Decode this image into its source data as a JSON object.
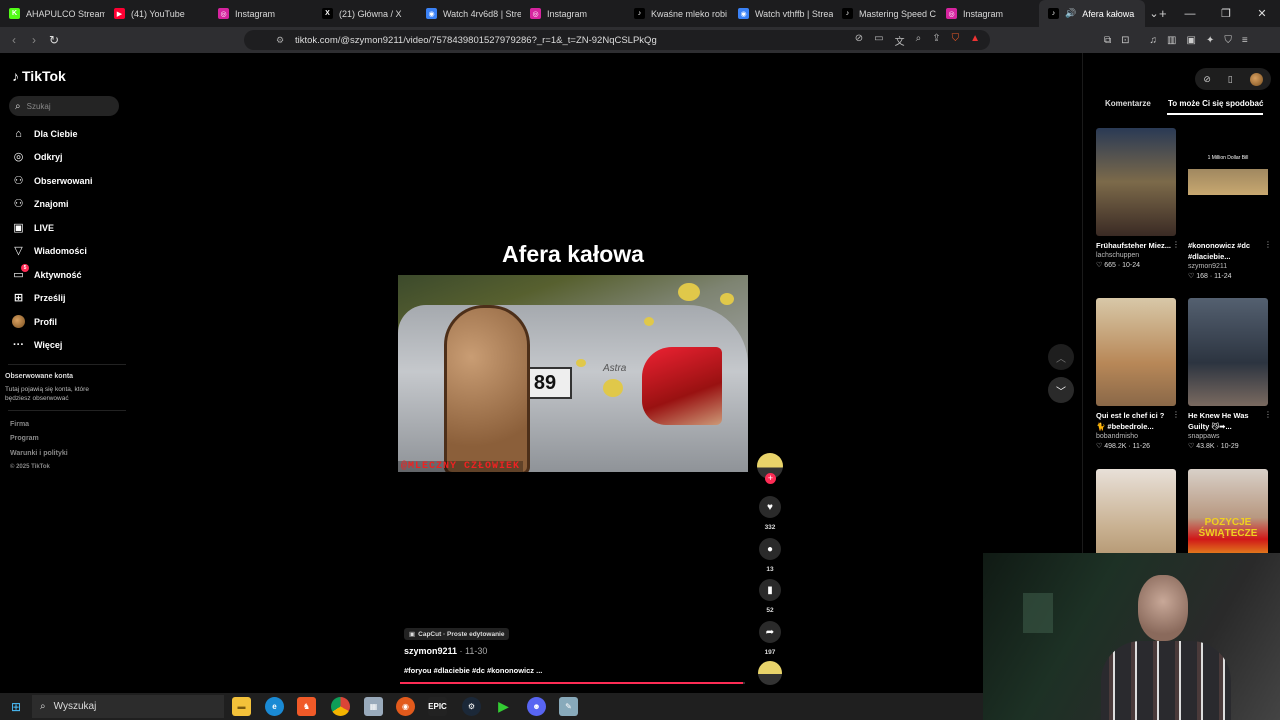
{
  "browser": {
    "tabs": [
      {
        "label": "AHAPULCO Stream",
        "fav": "K",
        "color": "#53fc18"
      },
      {
        "label": "(41) YouTube",
        "fav": "▶",
        "color": "#ff0033"
      },
      {
        "label": "Instagram",
        "fav": "◎",
        "color": "#d6249f"
      },
      {
        "label": "(21) Główna / X",
        "fav": "X",
        "color": "#000000"
      },
      {
        "label": "Watch 4rv6d8 | Stre",
        "fav": "◉",
        "color": "#3b82f6"
      },
      {
        "label": "Instagram",
        "fav": "◎",
        "color": "#d6249f"
      },
      {
        "label": "Kwaśne mleko robi",
        "fav": "♪",
        "color": "#000000"
      },
      {
        "label": "Watch vthffb | Strea",
        "fav": "◉",
        "color": "#3b82f6"
      },
      {
        "label": "Mastering Speed C",
        "fav": "♪",
        "color": "#000000"
      },
      {
        "label": "Instagram",
        "fav": "◎",
        "color": "#d6249f"
      }
    ],
    "active_tab": "Afera kałowa",
    "url": "tiktok.com/@szymon9211/video/7578439801527979286?_r=1&_t=ZN-92NqCSLPkQg"
  },
  "sidebar": {
    "logo": "TikTok",
    "search_placeholder": "Szukaj",
    "items": [
      {
        "label": "Dla Ciebie",
        "icon": "⌂"
      },
      {
        "label": "Odkryj",
        "icon": "◎"
      },
      {
        "label": "Obserwowani",
        "icon": "⚇"
      },
      {
        "label": "Znajomi",
        "icon": "⚇"
      },
      {
        "label": "LIVE",
        "icon": "▣"
      },
      {
        "label": "Wiadomości",
        "icon": "▽"
      },
      {
        "label": "Aktywność",
        "icon": "▭"
      },
      {
        "label": "Prześlij",
        "icon": "⊞"
      },
      {
        "label": "Profil",
        "icon": ""
      },
      {
        "label": "Więcej",
        "icon": "···"
      }
    ],
    "activity_badge": "5",
    "followed_title": "Obserwowane konta",
    "followed_text": "Tutaj pojawią się konta, które będziesz obserwować",
    "footer": [
      "Firma",
      "Program",
      "Warunki i polityki",
      "© 2025 TikTok"
    ]
  },
  "video": {
    "title": "Afera kałowa",
    "overlay_text": "@MLECZNY CZŁOWIEK",
    "plate_text": "89",
    "car_badge": "Astra",
    "capcut": "CapCut · Proste edytowanie",
    "username": "szymon9211",
    "date": " · 11-30",
    "hashtags": "#foryou #dlaciebie #dc #kononowicz ...",
    "progress": 0.995,
    "likes": "332",
    "comments": "13",
    "saves": "52",
    "shares": "197"
  },
  "panel": {
    "tab_comments": "Komentarze",
    "tab_recommended": "To może Ci się spodobać",
    "recs": [
      {
        "title": "Frühaufsteher Miez...",
        "user": "lachschuppen",
        "stats": "♡ 665 · 10-24",
        "bg": "linear-gradient(180deg,#2a3a55,#7c6a4a 50%,#3a2a24)"
      },
      {
        "title": "#kononowicz #dc #dlaciebie...",
        "user": "szymon9211",
        "stats": "♡ 168 · 11-24",
        "bg": "linear-gradient(180deg,#000 0%,#000 38%,#a08860 38%,#c8a870 62%,#000 62%)"
      },
      {
        "title": "Qui est le chef ici ? 🐈 #bebedrole...",
        "user": "bobandmisho",
        "stats": "♡ 498.2K · 11-26",
        "bg": "linear-gradient(180deg,#d8c8a8,#b88858 60%,#8a6848)"
      },
      {
        "title": "He Knew He Was Guilty 😼➡...",
        "user": "snappaws",
        "stats": "♡ 43.8K · 10-29",
        "bg": "linear-gradient(180deg,#546070,#2c3440 60%,#7a6a60)"
      },
      {
        "title": "",
        "user": "",
        "stats": "",
        "bg": "linear-gradient(180deg,#e8e0d8,#c8b090 55%,#a88860)"
      },
      {
        "title": "",
        "user": "",
        "stats": "",
        "bg": "linear-gradient(180deg,#d8d0c8 0%,#b89880 45%,#d01818 65%,#f0d020 90%)"
      }
    ],
    "thumb_caption": "1 Million Dollar Bill",
    "thumb_banner": "POZYCJE ŚWIĄTECZE"
  },
  "taskbar": {
    "search_placeholder": "Wyszukaj"
  }
}
